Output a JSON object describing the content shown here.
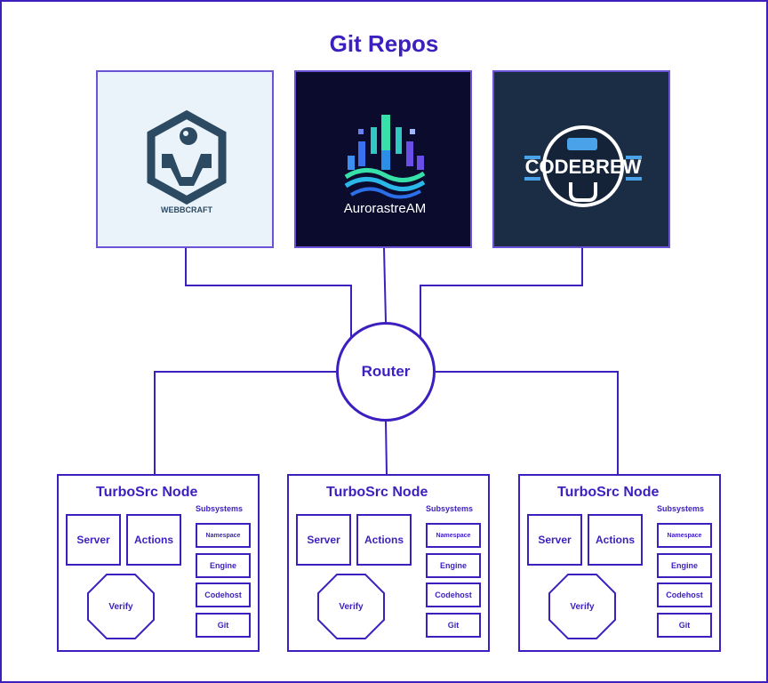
{
  "title": "Git Repos",
  "colors": {
    "accent": "#3d1fbf"
  },
  "repos": [
    {
      "name": "WEBBCRAFT",
      "logo": "webbcraft-logo",
      "background": "#eaf3f9"
    },
    {
      "name": "AurorastreAM",
      "logo": "aurorastream-logo",
      "background": "#0b0b2e"
    },
    {
      "name": "CODEBREW",
      "logo": "codebrew-logo",
      "background": "#1b2d45"
    }
  ],
  "router": {
    "label": "Router"
  },
  "nodes": [
    {
      "title": "TurboSrc Node",
      "components": [
        "Server",
        "Actions"
      ],
      "verify": "Verify",
      "subsystems_title": "Subsystems",
      "subsystems": [
        "Namespace",
        "Engine",
        "Codehost",
        "Git"
      ]
    },
    {
      "title": "TurboSrc Node",
      "components": [
        "Server",
        "Actions"
      ],
      "verify": "Verify",
      "subsystems_title": "Subsystems",
      "subsystems": [
        "Namespace",
        "Engine",
        "Codehost",
        "Git"
      ]
    },
    {
      "title": "TurboSrc Node",
      "components": [
        "Server",
        "Actions"
      ],
      "verify": "Verify",
      "subsystems_title": "Subsystems",
      "subsystems": [
        "Namespace",
        "Engine",
        "Codehost",
        "Git"
      ]
    }
  ]
}
